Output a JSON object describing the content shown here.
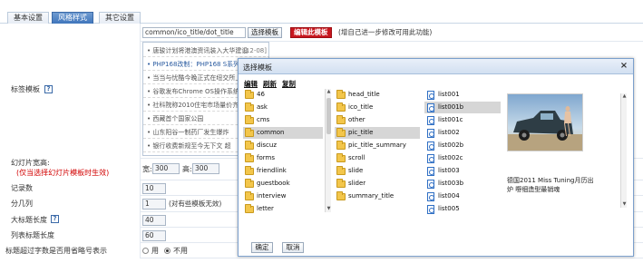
{
  "tabs": [
    "基本设置",
    "风格样式",
    "其它设置"
  ],
  "active_tab": 1,
  "template_path": {
    "value": "common/ico_title/dot_title",
    "select_label": "选择模板",
    "edit_label": "编辑此模板",
    "hint": "(增自己进一步修改可用此功能)"
  },
  "news_items": [
    {
      "text": "• 唐骏计划将港澳资讯装入大华建设",
      "date": "[12-08]"
    },
    {
      "text": "• PHP168改制：PHP168 S系列从",
      "date": ""
    },
    {
      "text": "• 当当与忧酷今晚正式在纽交所上市",
      "date": ""
    },
    {
      "text": "• 谷歌发布Chrome OS操作系统",
      "date": ""
    },
    {
      "text": "• 社科院称2010住宅市场量价齐",
      "date": ""
    },
    {
      "text": "• 西藏首个国家公园",
      "date": ""
    },
    {
      "text": "• 山东阳谷一制药厂发生爆炸",
      "date": ""
    },
    {
      "text": "• 银行收费新规至今无下文 超",
      "date": ""
    }
  ],
  "form": {
    "template_label": "标签模板",
    "slide_size_label": "幻灯片宽高:",
    "slide_size_note": "(仅当选择幻灯片模板时生效)",
    "width_label": "宽:",
    "width_value": "300",
    "height_label": "高:",
    "height_value": "300",
    "records_label": "记录数",
    "records_value": "10",
    "columns_label": "分几列",
    "columns_value": "1",
    "columns_note": "(对有些模板无效)",
    "title_len_label": "大标题长度",
    "title_len_value": "40",
    "list_title_len_label": "列表标题长度",
    "list_title_len_value": "60",
    "ellipsis_label": "标题超过字数是否用省略号表示",
    "ellipsis_yes": "用",
    "ellipsis_no": "不用",
    "ellipsis_selected": "不用"
  },
  "dialog": {
    "title": "选择模板",
    "toolbar": [
      "编辑",
      "刷新",
      "复制"
    ],
    "col1": [
      "46",
      "ask",
      "cms",
      "common",
      "discuz",
      "forms",
      "friendlink",
      "guestbook",
      "interview",
      "letter"
    ],
    "col1_selected": "common",
    "col2": [
      "head_title",
      "ico_title",
      "other",
      "pic_title",
      "pic_title_summary",
      "scroll",
      "slide",
      "slider",
      "summary_title"
    ],
    "col2_selected": "pic_title",
    "col3": [
      "list001",
      "list001b",
      "list001c",
      "list002",
      "list002b",
      "list002c",
      "list003",
      "list003b",
      "list004",
      "list005"
    ],
    "col3_selected": "list001b",
    "preview_caption": "德国2011 Miss Tuning月历出炉 嘢细造型最销魂",
    "ok_label": "确定",
    "cancel_label": "取消"
  },
  "colors": {
    "accent": "#3f75bb",
    "edit_button": "#c8161e",
    "note_red": "#d20000"
  }
}
